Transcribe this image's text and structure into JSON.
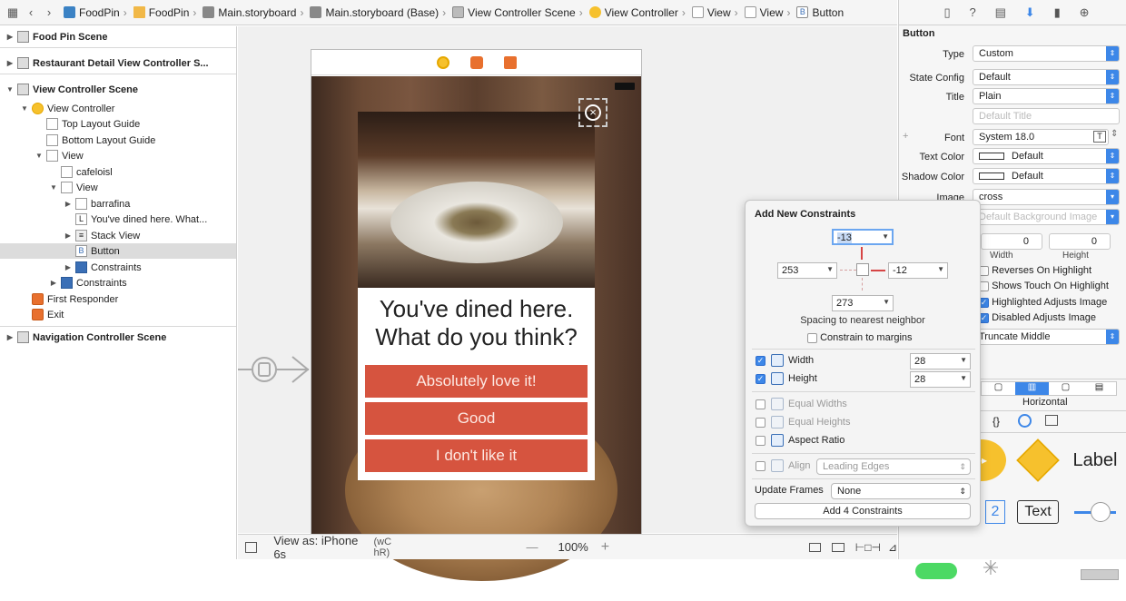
{
  "breadcrumb": [
    {
      "label": "FoodPin",
      "icon": "project-file-icon"
    },
    {
      "label": "FoodPin",
      "icon": "folder-icon"
    },
    {
      "label": "Main.storyboard",
      "icon": "storyboard-icon"
    },
    {
      "label": "Main.storyboard (Base)",
      "icon": "storyboard-icon"
    },
    {
      "label": "View Controller Scene",
      "icon": "scene-icon"
    },
    {
      "label": "View Controller",
      "icon": "view-controller-icon"
    },
    {
      "label": "View",
      "icon": "view-icon"
    },
    {
      "label": "View",
      "icon": "view-icon"
    },
    {
      "label": "Button",
      "icon": "button-icon"
    }
  ],
  "outline": {
    "food_pin_scene": "Food Pin Scene",
    "restaurant_detail_scene": "Restaurant Detail View Controller S...",
    "vc_scene": "View Controller Scene",
    "view_controller": "View Controller",
    "top_layout_guide": "Top Layout Guide",
    "bottom_layout_guide": "Bottom Layout Guide",
    "view": "View",
    "cafeloisl": "cafeloisl",
    "inner_view": "View",
    "barrafina": "barrafina",
    "label_dined": "You've dined here. What...",
    "stack_view": "Stack View",
    "button": "Button",
    "constraints_inner": "Constraints",
    "constraints_outer": "Constraints",
    "first_responder": "First Responder",
    "exit": "Exit",
    "nav_scene": "Navigation Controller Scene"
  },
  "canvas": {
    "headline_line1": "You've dined here.",
    "headline_line2": "What do you think?",
    "buttons": [
      "Absolutely love it!",
      "Good",
      "I don't like it"
    ],
    "view_as": "View as: iPhone 6s",
    "size_class": "(wC hR)",
    "zoom_minus": "—",
    "zoom": "100%",
    "zoom_plus": "+"
  },
  "inspector": {
    "section": "Button",
    "type_label": "Type",
    "type_value": "Custom",
    "state_label": "State Config",
    "state_value": "Default",
    "title_label": "Title",
    "title_value": "Plain",
    "title_placeholder": "Default Title",
    "font_label": "Font",
    "font_value": "System 18.0",
    "text_color_label": "Text Color",
    "text_color_value": "Default",
    "shadow_color_label": "Shadow Color",
    "shadow_color_value": "Default",
    "image_label": "Image",
    "image_value": "cross",
    "bg_placeholder": "Default Background Image",
    "width_value": "0",
    "height_value": "0",
    "width_label": "Width",
    "height_label": "Height",
    "reverses": "Reverses On Highlight",
    "shows_touch": "Shows Touch On Highlight",
    "highlighted_adjusts": "Highlighted Adjusts Image",
    "disabled_adjusts": "Disabled Adjusts Image",
    "line_break": "Truncate Middle",
    "horizontal": "Horizontal",
    "library_label": "Label",
    "library_text": "Text",
    "library_two": "2"
  },
  "popover": {
    "title": "Add New Constraints",
    "top": "-13",
    "left": "253",
    "right": "-12",
    "bottom": "273",
    "spacing_caption": "Spacing to nearest neighbor",
    "constrain_margins": "Constrain to margins",
    "width_label": "Width",
    "width_value": "28",
    "height_label": "Height",
    "height_value": "28",
    "equal_widths": "Equal Widths",
    "equal_heights": "Equal Heights",
    "aspect_ratio": "Aspect Ratio",
    "align_label": "Align",
    "align_value": "Leading Edges",
    "update_frames_label": "Update Frames",
    "update_frames_value": "None",
    "add_button": "Add 4 Constraints"
  },
  "colors": {
    "accent": "#3d87e8",
    "option_button": "#d6543f"
  }
}
